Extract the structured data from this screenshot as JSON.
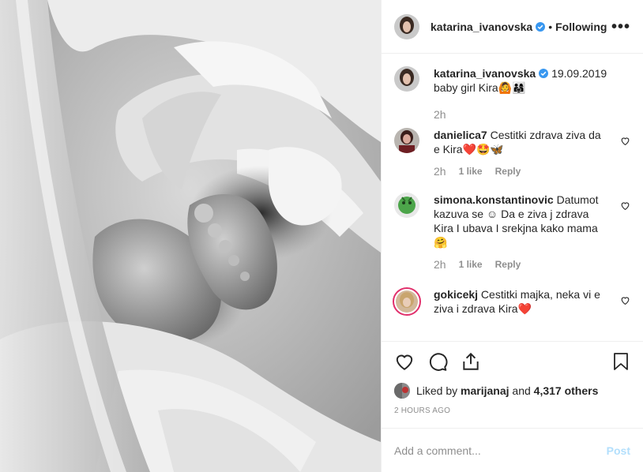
{
  "post": {
    "author": "katarina_ivanovska",
    "follow_status": "Following",
    "more_label": "•••",
    "dot": "•"
  },
  "caption": {
    "author": "katarina_ivanovska",
    "date": "19.09.2019",
    "text": "baby girl Kira🙆👨‍👩‍👧",
    "time": "2h"
  },
  "comments": [
    {
      "user": "danielica7",
      "text": "Cestitki zdrava ziva da e Kira❤️🤩🦋",
      "time": "2h",
      "likes": "1 like",
      "reply": "Reply"
    },
    {
      "user": "simona.konstantinovic",
      "text": "Datumot kazuva se ☺ Da e ziva j zdrava Kira I ubava I srekjna kako mama 🤗",
      "time": "2h",
      "likes": "1 like",
      "reply": "Reply"
    },
    {
      "user": "gokicekj",
      "text": "Cestitki majka, neka vi e ziva i zdrava Kira❤️"
    }
  ],
  "likes": {
    "prefix": "Liked by",
    "user": "marijanaj",
    "and": "and",
    "count": "4,317 others"
  },
  "time_ago": "2 HOURS AGO",
  "add_comment": {
    "placeholder": "Add a comment...",
    "post_label": "Post"
  },
  "colors": {
    "verified": "#3897f0",
    "post_button_disabled": "#b2dffc",
    "muted": "#8e8e8e"
  }
}
